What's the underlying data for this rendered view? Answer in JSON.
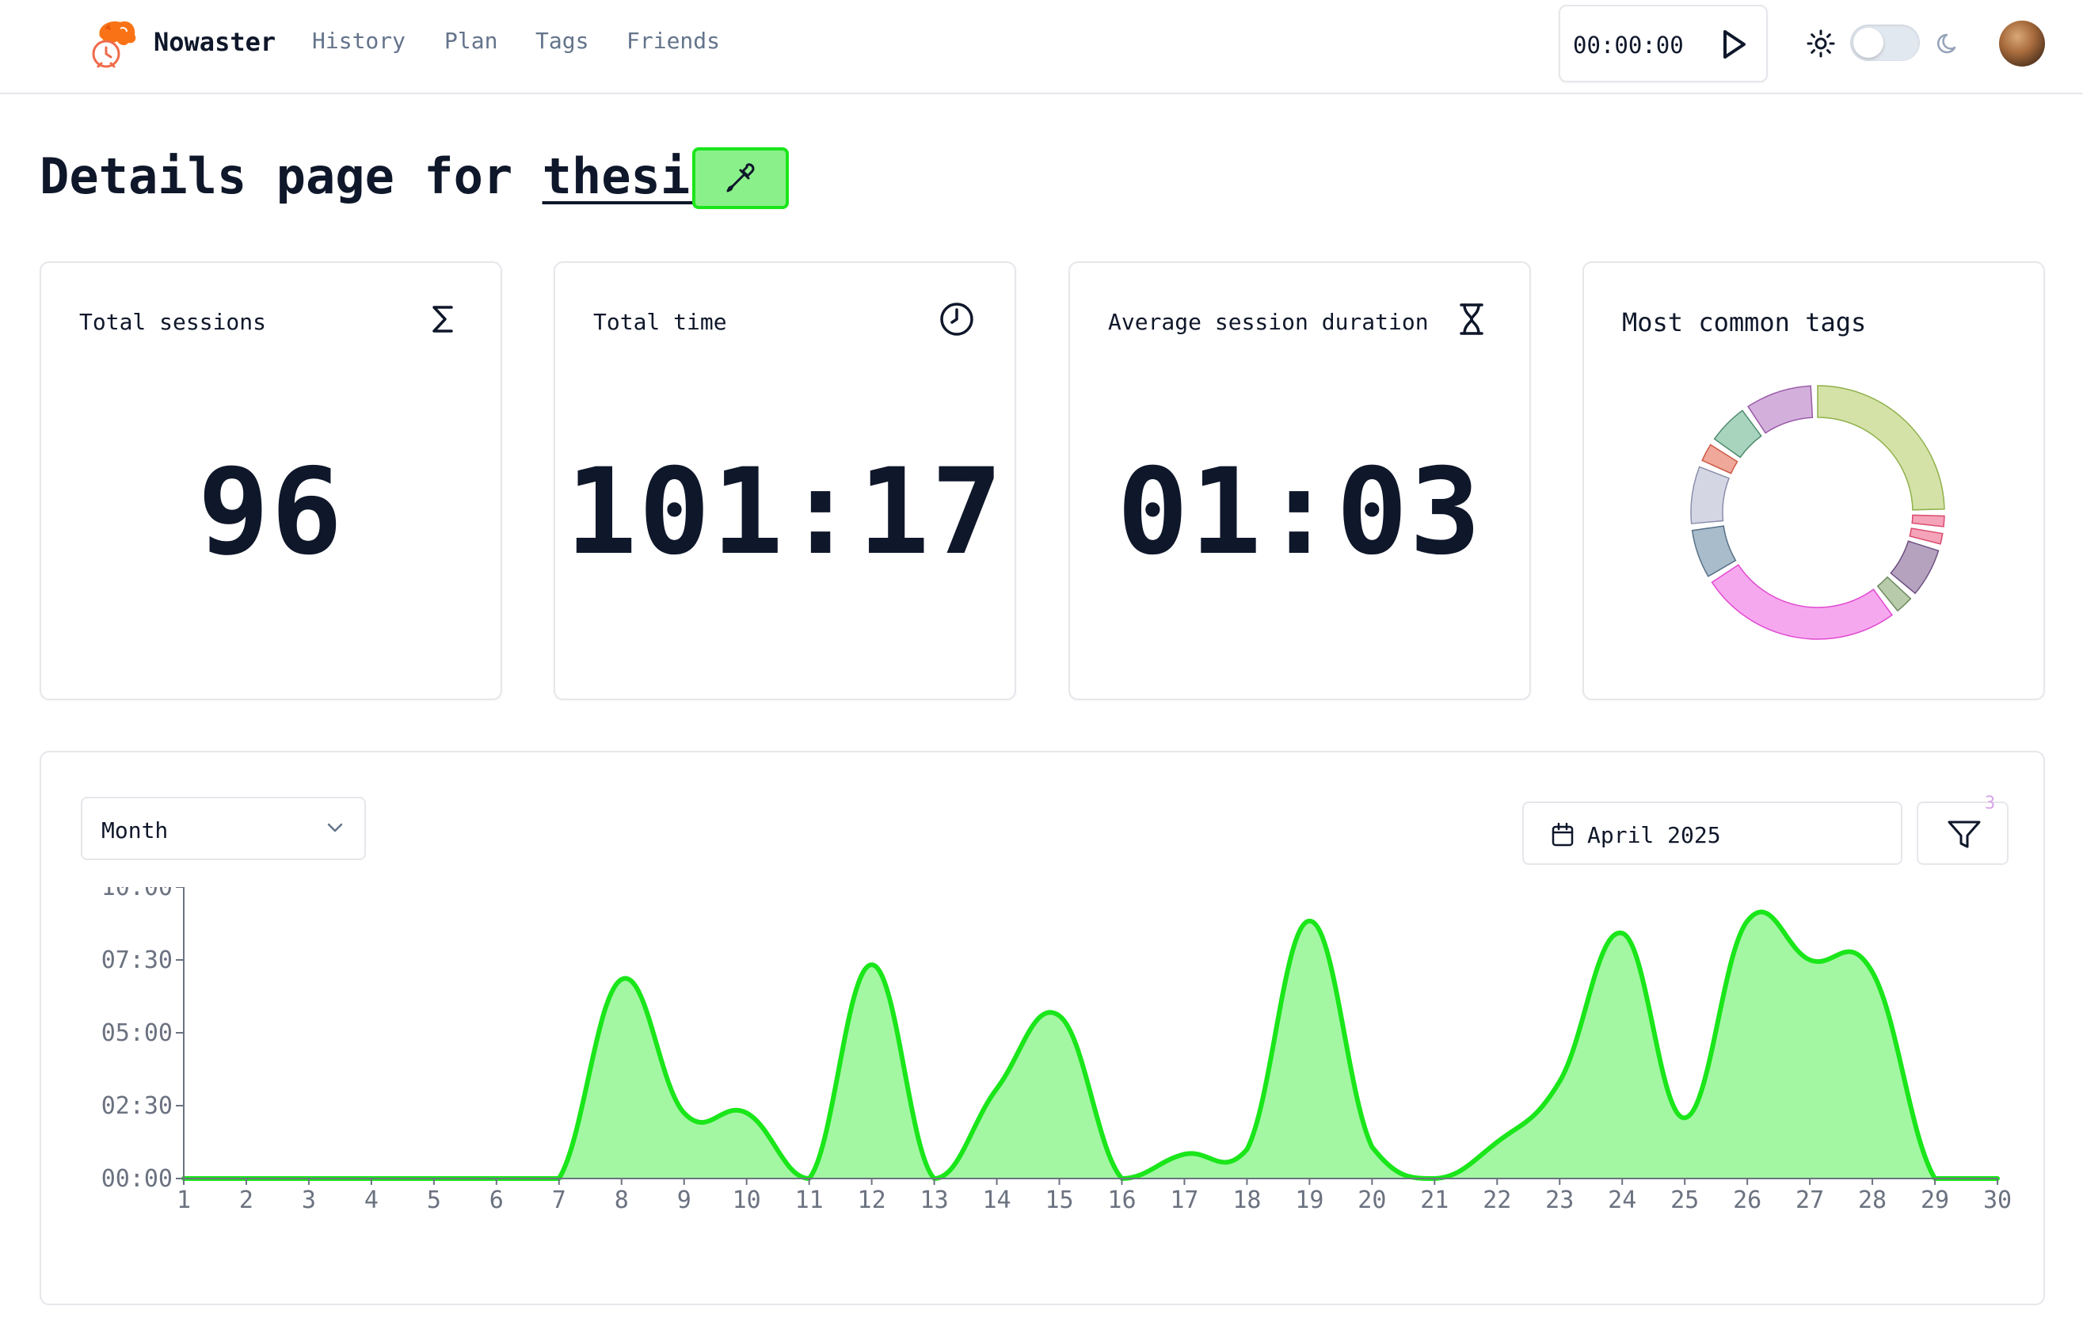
{
  "app": {
    "name": "Nowaster",
    "nav": [
      {
        "label": "History"
      },
      {
        "label": "Plan"
      },
      {
        "label": "Tags"
      },
      {
        "label": "Friends"
      }
    ],
    "timer": "00:00:00"
  },
  "page": {
    "title_prefix": "Details page for",
    "project_name": "thesis",
    "project_color": "#8af08a"
  },
  "stats": {
    "total_sessions": {
      "label": "Total sessions",
      "value": "96",
      "icon": "sigma-icon"
    },
    "total_time": {
      "label": "Total time",
      "value": "101:17",
      "icon": "clock-icon"
    },
    "avg_duration": {
      "label": "Average session duration",
      "value": "01:03",
      "icon": "hourglass-icon"
    },
    "common_tags": {
      "label": "Most common tags"
    }
  },
  "tag_segments": [
    {
      "value": 22,
      "color": "#d4e2a8",
      "stroke": "#8fb04a"
    },
    {
      "value": 1.2,
      "color": "#f5a3b8",
      "stroke": "#d94a6e"
    },
    {
      "value": 1.2,
      "color": "#f5a3b8",
      "stroke": "#d94a6e"
    },
    {
      "value": 5.5,
      "color": "#b4a2bf",
      "stroke": "#6e4f80"
    },
    {
      "value": 2,
      "color": "#b8ccab",
      "stroke": "#6e8a5e"
    },
    {
      "value": 23,
      "color": "#f6a8ef",
      "stroke": "#e04ad0"
    },
    {
      "value": 5.5,
      "color": "#a9bccb",
      "stroke": "#557088"
    },
    {
      "value": 6.5,
      "color": "#d4d6e4",
      "stroke": "#8b8faa"
    },
    {
      "value": 2,
      "color": "#f0a89a",
      "stroke": "#cc5a45"
    },
    {
      "value": 4.5,
      "color": "#a8d4be",
      "stroke": "#4f8a6e"
    },
    {
      "value": 7.5,
      "color": "#d3b0dc",
      "stroke": "#9a5aa8"
    }
  ],
  "controls": {
    "range": "Month",
    "date": "April 2025",
    "filter_count": "3"
  },
  "chart_data": {
    "type": "area",
    "color": "#1ae61a",
    "fill": "#a3f7a3",
    "x": [
      1,
      2,
      3,
      4,
      5,
      6,
      7,
      8,
      9,
      10,
      11,
      12,
      13,
      14,
      15,
      16,
      17,
      18,
      19,
      20,
      21,
      22,
      23,
      24,
      25,
      26,
      27,
      28,
      29,
      30
    ],
    "x_tick_labels": [
      "1",
      "2",
      "3",
      "4",
      "5",
      "6",
      "7",
      "8",
      "9",
      "10",
      "11",
      "12",
      "13",
      "14",
      "15",
      "16",
      "17",
      "18",
      "19",
      "20",
      "21",
      "22",
      "23",
      "24",
      "25",
      "26",
      "27",
      "28",
      "29",
      "30"
    ],
    "y_minutes": [
      0,
      0,
      0,
      0,
      0,
      0,
      0,
      410,
      135,
      135,
      0,
      440,
      0,
      185,
      335,
      0,
      50,
      60,
      530,
      65,
      0,
      75,
      200,
      505,
      125,
      530,
      450,
      425,
      0,
      0
    ],
    "y_ticks": [
      0,
      150,
      300,
      450,
      600
    ],
    "y_tick_labels": [
      "00:00",
      "02:30",
      "05:00",
      "07:30",
      "10:00"
    ],
    "ylim": [
      0,
      600
    ]
  }
}
